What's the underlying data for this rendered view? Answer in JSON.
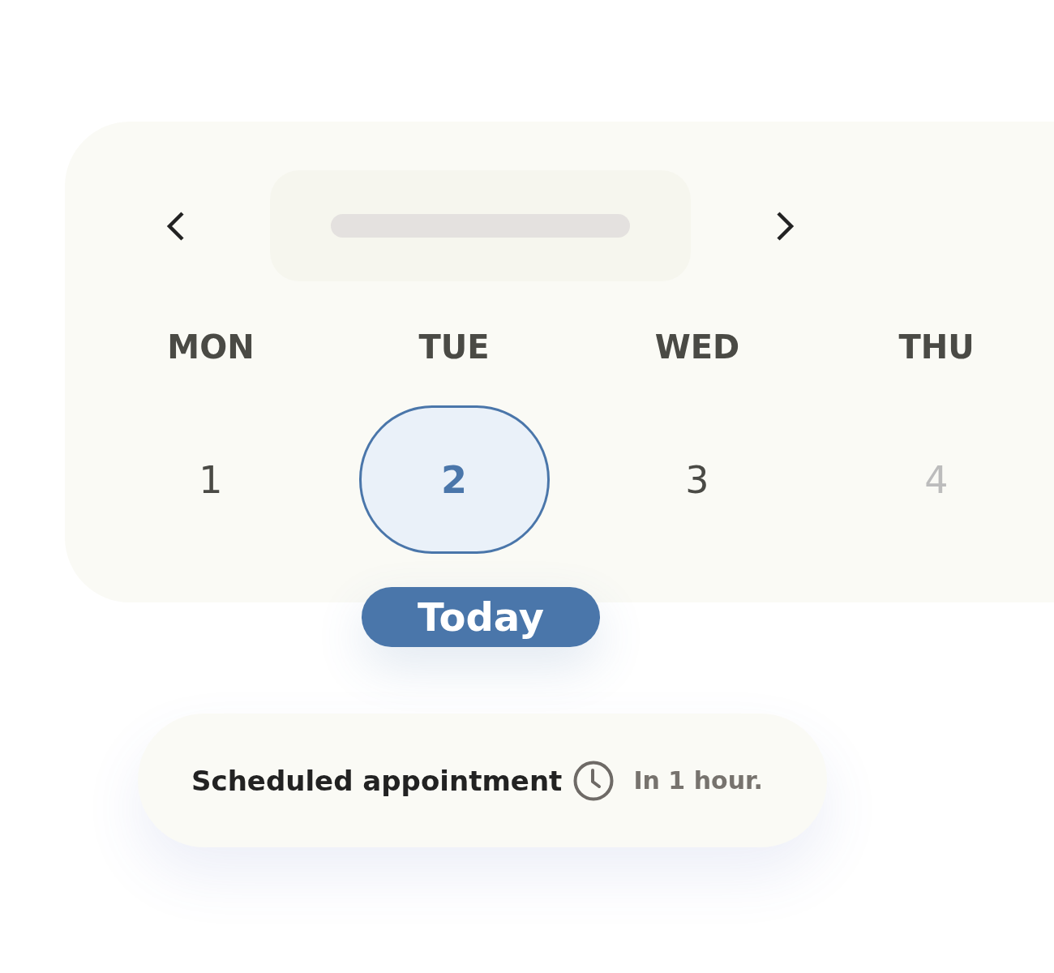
{
  "calendar": {
    "days": [
      {
        "weekday": "MON",
        "date": "1",
        "selected": false,
        "disabled": false
      },
      {
        "weekday": "TUE",
        "date": "2",
        "selected": true,
        "disabled": false,
        "badge": "Today"
      },
      {
        "weekday": "WED",
        "date": "3",
        "selected": false,
        "disabled": false
      },
      {
        "weekday": "THU",
        "date": "4",
        "selected": false,
        "disabled": true
      }
    ]
  },
  "appointment": {
    "title": "Scheduled appointment",
    "time": "In 1 hour."
  }
}
